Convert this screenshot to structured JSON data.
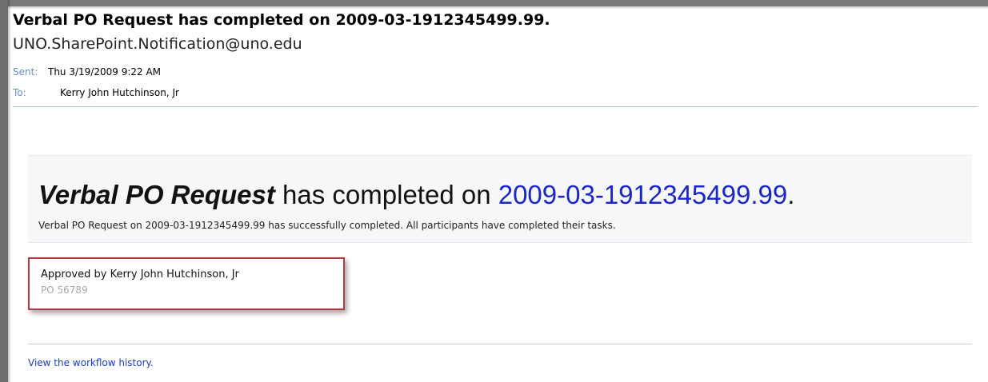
{
  "email": {
    "subject": "Verbal PO Request has completed on 2009-03-1912345499.99.",
    "sender": "UNO.SharePoint.Notification@uno.edu",
    "sent_label": "Sent:",
    "sent_value": "Thu 3/19/2009 9:22 AM",
    "to_label": "To:",
    "to_value": "Kerry John Hutchinson, Jr"
  },
  "banner": {
    "workflow_name": "Verbal PO Request",
    "headline_middle": " has completed on ",
    "headline_date": "2009-03-1912345499.99",
    "headline_end": ".",
    "description": "Verbal PO Request on 2009-03-1912345499.99 has successfully completed. All participants have completed their tasks."
  },
  "approval": {
    "approved_by": "Approved by Kerry John Hutchinson, Jr",
    "po_number": "PO 56789"
  },
  "footer": {
    "history_link": "View the workflow history."
  },
  "colors": {
    "link": "#1a3cc9",
    "headline_date": "#1a26c9",
    "label_blue": "#6a8fc8",
    "highlight_border": "#b33a3a"
  }
}
